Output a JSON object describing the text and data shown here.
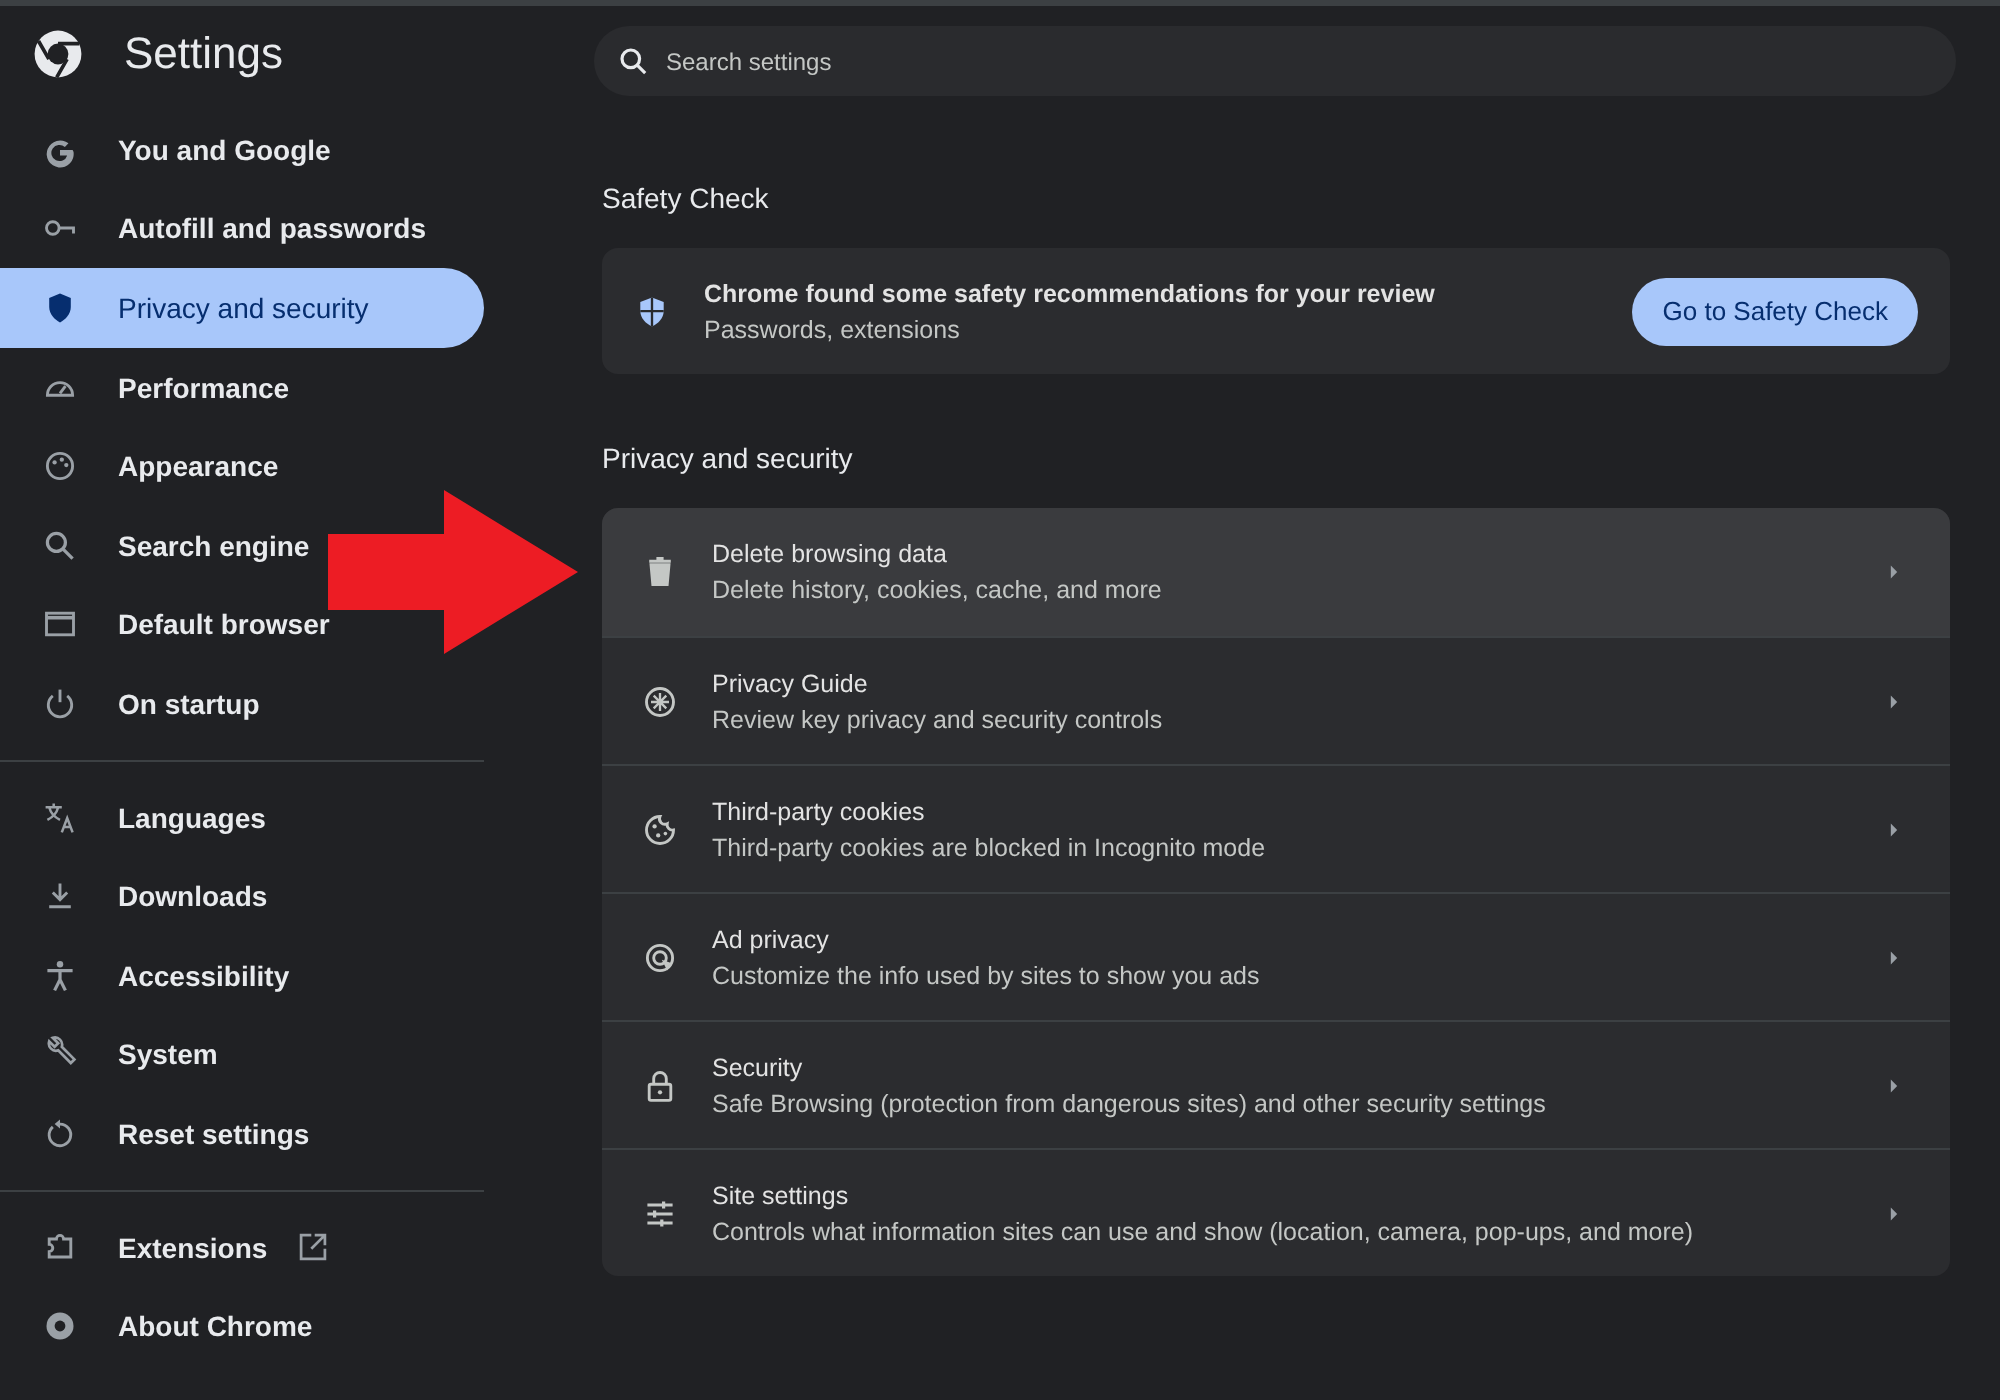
{
  "header": {
    "title": "Settings"
  },
  "search": {
    "placeholder": "Search settings"
  },
  "sidebar": {
    "groups": [
      {
        "items": [
          {
            "label": "You and Google",
            "selected": false
          },
          {
            "label": "Autofill and passwords",
            "selected": false
          },
          {
            "label": "Privacy and security",
            "selected": true
          },
          {
            "label": "Performance",
            "selected": false
          },
          {
            "label": "Appearance",
            "selected": false
          },
          {
            "label": "Search engine",
            "selected": false
          },
          {
            "label": "Default browser",
            "selected": false
          },
          {
            "label": "On startup",
            "selected": false
          }
        ]
      },
      {
        "items": [
          {
            "label": "Languages",
            "selected": false
          },
          {
            "label": "Downloads",
            "selected": false
          },
          {
            "label": "Accessibility",
            "selected": false
          },
          {
            "label": "System",
            "selected": false
          },
          {
            "label": "Reset settings",
            "selected": false
          }
        ]
      },
      {
        "items": [
          {
            "label": "Extensions",
            "selected": false
          },
          {
            "label": "About Chrome",
            "selected": false
          }
        ]
      }
    ]
  },
  "safety_check": {
    "heading": "Safety Check",
    "title": "Chrome found some safety recommendations for your review",
    "subtitle": "Passwords, extensions",
    "button": "Go to Safety Check"
  },
  "privacy": {
    "heading": "Privacy and security",
    "rows": [
      {
        "title": "Delete browsing data",
        "subtitle": "Delete history, cookies, cache, and more",
        "highlighted": true
      },
      {
        "title": "Privacy Guide",
        "subtitle": "Review key privacy and security controls",
        "highlighted": false
      },
      {
        "title": "Third-party cookies",
        "subtitle": "Third-party cookies are blocked in Incognito mode",
        "highlighted": false
      },
      {
        "title": "Ad privacy",
        "subtitle": "Customize the info used by sites to show you ads",
        "highlighted": false
      },
      {
        "title": "Security",
        "subtitle": "Safe Browsing (protection from dangerous sites) and other security settings",
        "highlighted": false
      },
      {
        "title": "Site settings",
        "subtitle": "Controls what information sites can use and show (location, camera, pop-ups, and more)",
        "highlighted": false
      }
    ]
  }
}
